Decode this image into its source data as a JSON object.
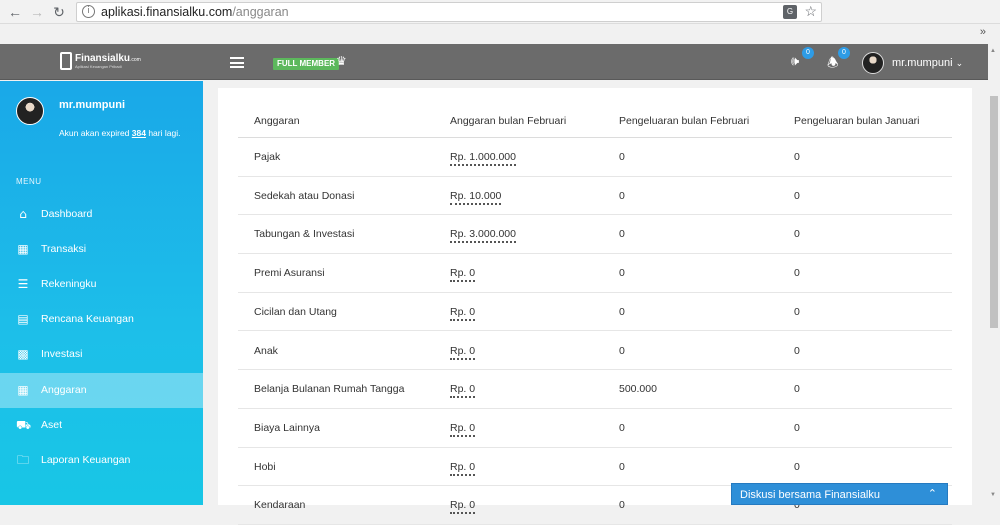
{
  "browser": {
    "url_host": "aplikasi.finansialku.com",
    "url_path": "/anggaran",
    "more": "»"
  },
  "header": {
    "logo": "Finansialku",
    "logo_tld": ".com",
    "logo_tagline": "Aplikasi Keuangan Pribadi",
    "member_badge": "FULL MEMBER",
    "speaker_badge": "0",
    "bell_badge": "0",
    "username": "mr.mumpuni"
  },
  "sidebar": {
    "username": "mr.mumpuni",
    "expire_prefix": "Akun akan expired ",
    "expire_days": "384",
    "expire_suffix": " hari lagi.",
    "menu_heading": "MENU",
    "items": [
      {
        "label": "Dashboard",
        "icon": "home-icon"
      },
      {
        "label": "Transaksi",
        "icon": "table-icon"
      },
      {
        "label": "Rekeningku",
        "icon": "layers-icon"
      },
      {
        "label": "Rencana Keuangan",
        "icon": "clipboard-icon"
      },
      {
        "label": "Investasi",
        "icon": "chart-icon"
      },
      {
        "label": "Anggaran",
        "icon": "table-icon",
        "active": true
      },
      {
        "label": "Aset",
        "icon": "car-icon"
      },
      {
        "label": "Laporan Keuangan",
        "icon": "folder-icon"
      }
    ]
  },
  "table": {
    "headers": [
      "Anggaran",
      "Anggaran bulan Februari",
      "Pengeluaran bulan Februari",
      "Pengeluaran bulan Januari"
    ],
    "rows": [
      [
        "Pajak",
        "Rp. 1.000.000",
        "0",
        "0"
      ],
      [
        "Sedekah atau Donasi",
        "Rp. 10.000",
        "0",
        "0"
      ],
      [
        "Tabungan & Investasi",
        "Rp. 3.000.000",
        "0",
        "0"
      ],
      [
        "Premi Asuransi",
        "Rp. 0",
        "0",
        "0"
      ],
      [
        "Cicilan dan Utang",
        "Rp. 0",
        "0",
        "0"
      ],
      [
        "Anak",
        "Rp. 0",
        "0",
        "0"
      ],
      [
        "Belanja Bulanan Rumah Tangga",
        "Rp. 0",
        "500.000",
        "0"
      ],
      [
        "Biaya Lainnya",
        "Rp. 0",
        "0",
        "0"
      ],
      [
        "Hobi",
        "Rp. 0",
        "0",
        "0"
      ],
      [
        "Kendaraan",
        "Rp. 0",
        "0",
        "0"
      ]
    ]
  },
  "chat": {
    "label": "Diskusi bersama Finansialku"
  }
}
